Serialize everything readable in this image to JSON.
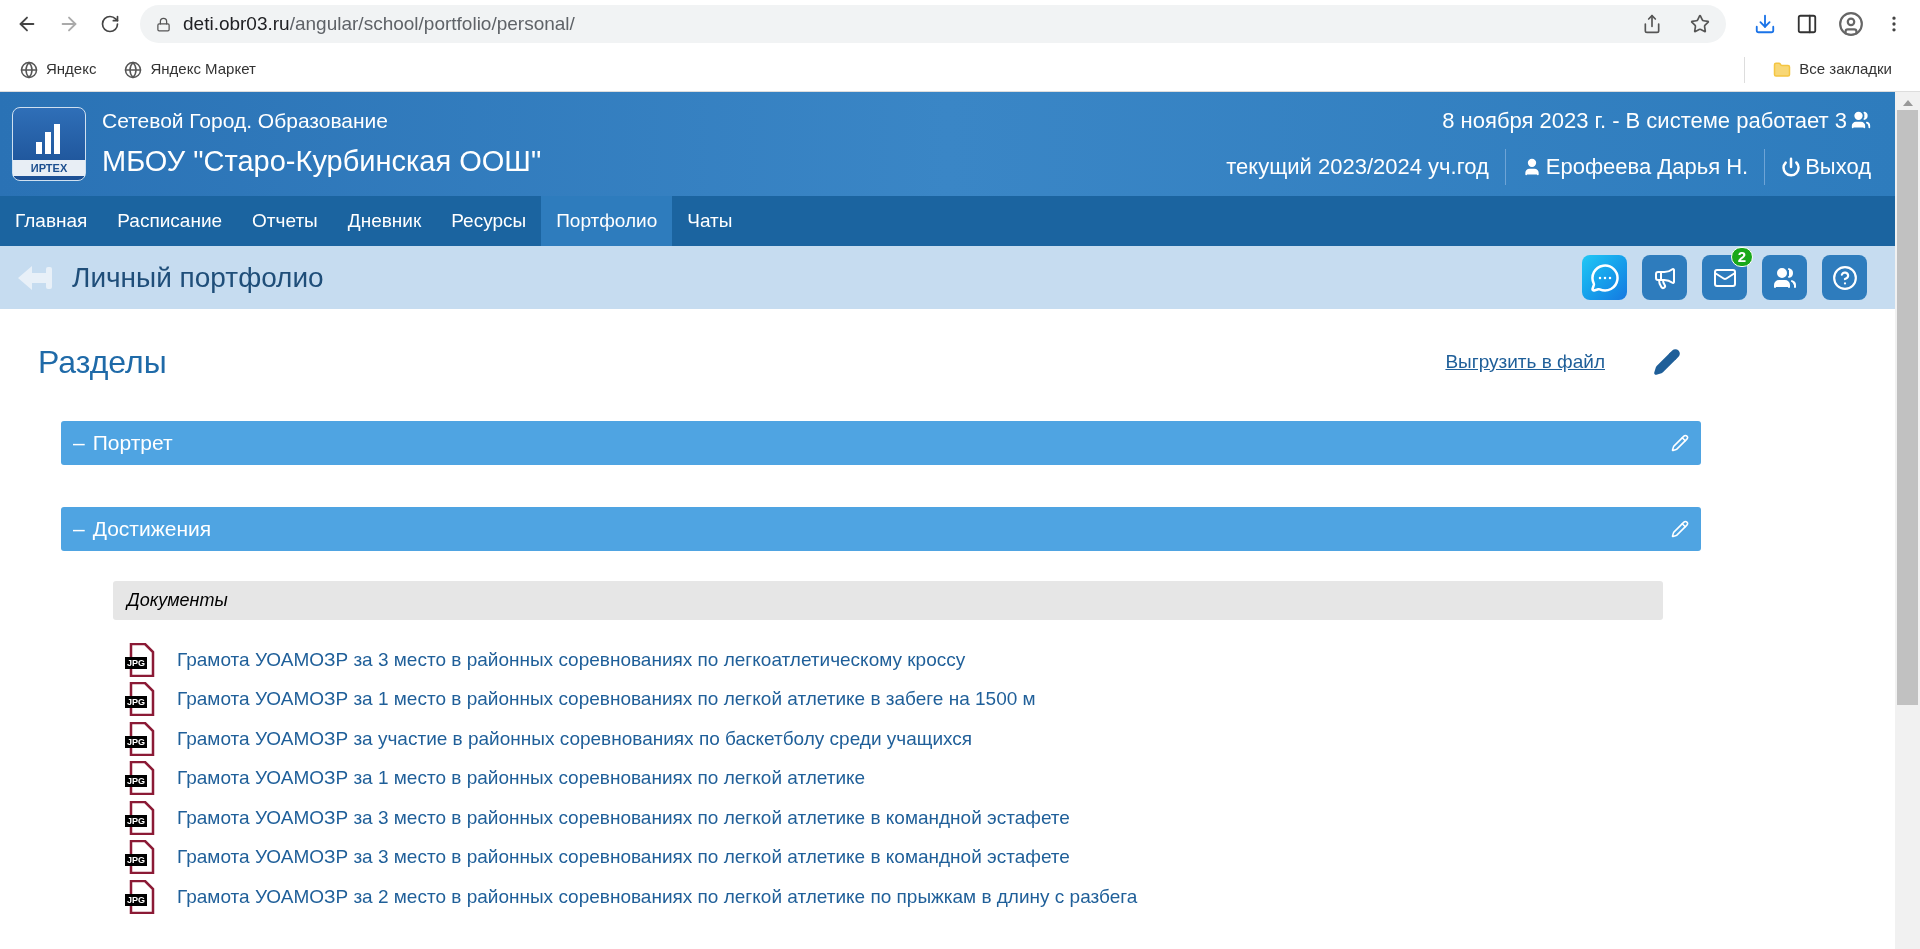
{
  "browser": {
    "url_host": "deti.obr03.ru",
    "url_path": "/angular/school/portfolio/personal/",
    "bookmarks": [
      "Яндекс",
      "Яндекс Маркет"
    ],
    "all_bookmarks": "Все закладки"
  },
  "header": {
    "logo_text": "ИРТЕХ",
    "system_name": "Сетевой Город. Образование",
    "school": "МБОУ \"Старо-Курбинская ООШ\"",
    "status": "8 ноября 2023 г. - В системе работает 3",
    "year": "текущий 2023/2024 уч.год",
    "user": "Ерофеева Дарья Н.",
    "logout": "Выход"
  },
  "nav": [
    {
      "label": "Главная",
      "selected": false
    },
    {
      "label": "Расписание",
      "selected": false
    },
    {
      "label": "Отчеты",
      "selected": false
    },
    {
      "label": "Дневник",
      "selected": false
    },
    {
      "label": "Ресурсы",
      "selected": false
    },
    {
      "label": "Портфолио",
      "selected": true
    },
    {
      "label": "Чаты",
      "selected": false
    }
  ],
  "page": {
    "title": "Личный портфолио",
    "mail_badge": "2"
  },
  "content": {
    "heading": "Разделы",
    "export_link": "Выгрузить в файл",
    "sections": [
      {
        "toggle": "–",
        "title": "Портрет",
        "expanded": true
      },
      {
        "toggle": "–",
        "title": "Достижения",
        "expanded": true
      }
    ],
    "documents_heading": "Документы",
    "documents": [
      {
        "file_type": "JPG",
        "title": "Грамота УОАМОЗР за 3 место в районных соревнованиях по легкоатлетическому кроссу"
      },
      {
        "file_type": "JPG",
        "title": "Грамота УОАМОЗР за 1 место в районных соревнованиях по легкой атлетике в забеге на 1500 м"
      },
      {
        "file_type": "JPG",
        "title": "Грамота УОАМОЗР за участие в районных соревнованиях по баскетболу среди учащихся"
      },
      {
        "file_type": "JPG",
        "title": "Грамота УОАМОЗР за 1 место в районных соревнованиях по легкой атлетике"
      },
      {
        "file_type": "JPG",
        "title": "Грамота УОАМОЗР за 3 место в районных соревнованиях по легкой атлетике в командной эстафете"
      },
      {
        "file_type": "JPG",
        "title": "Грамота УОАМОЗР за 3 место в районных соревнованиях по легкой атлетике в командной эстафете"
      },
      {
        "file_type": "JPG",
        "title": "Грамота УОАМОЗР за 2 место в районных соревнованиях по легкой атлетике по прыжкам в длину с разбега"
      }
    ]
  }
}
